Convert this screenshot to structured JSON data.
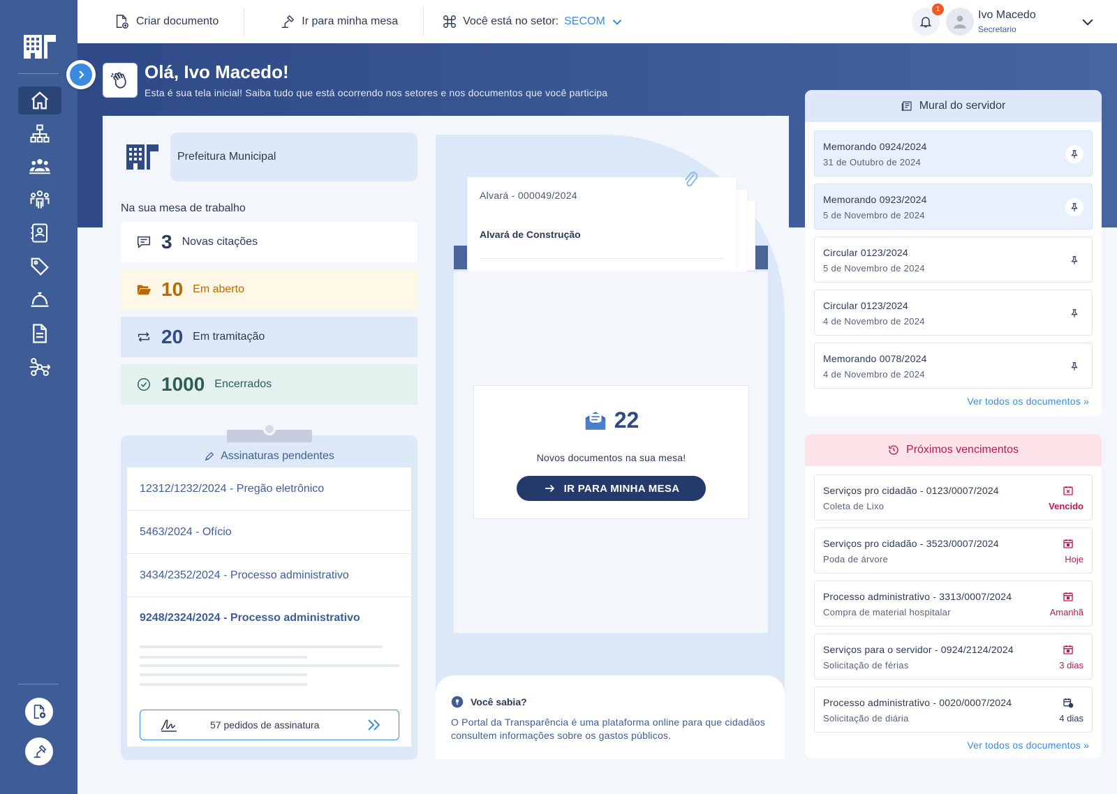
{
  "topbar": {
    "create_doc": "Criar documento",
    "go_desk": "Ir para minha mesa",
    "sector_label": "Você está no setor:",
    "sector_value": "SECOM",
    "notif_count": "1",
    "user_name": "Ivo Macedo",
    "user_role": "Secretario"
  },
  "hero": {
    "title": "Olá, Ivo Macedo!",
    "subtitle": "Esta é sua tela inicial! Saiba tudo que está ocorrendo nos setores e nos documentos que você participa"
  },
  "org": {
    "name": "Prefeitura Municipal"
  },
  "desk": {
    "title": "Na sua mesa de trabalho",
    "stats": [
      {
        "num": "3",
        "label": "Novas citações"
      },
      {
        "num": "10",
        "label": "Em aberto"
      },
      {
        "num": "20",
        "label": "Em tramitação"
      },
      {
        "num": "1000",
        "label": "Encerrados"
      }
    ]
  },
  "signatures": {
    "title": "Assinaturas pendentes",
    "items": [
      "12312/1232/2024 - Pregão eletrônico",
      "5463/2024 - Ofício",
      "3434/2352/2024 - Processo administrativo",
      "9248/2324/2024 - Processo administrativo"
    ],
    "button": "57 pedidos de assinatura"
  },
  "inbox": {
    "doc_number": "Alvará - 000049/2024",
    "doc_title": "Alvará de Construção",
    "count": "22",
    "label": "Novos documentos na sua mesa!",
    "button": "IR PARA MINHA MESA"
  },
  "tip": {
    "title": "Você sabia?",
    "text": "O Portal da Transparência é uma plataforma online para que cidadãos consultem informações sobre os gastos públicos."
  },
  "mural": {
    "title": "Mural do servidor",
    "items": [
      {
        "title": "Memorando 0924/2024",
        "date": "31 de Outubro de 2024"
      },
      {
        "title": "Memorando 0923/2024",
        "date": "5 de Novembro de 2024"
      },
      {
        "title": "Circular 0123/2024",
        "date": "5 de Novembro de 2024"
      },
      {
        "title": "Circular 0123/2024",
        "date": "4 de Novembro de 2024"
      },
      {
        "title": "Memorando 0078/2024",
        "date": "4 de Novembro de 2024"
      }
    ],
    "see_all": "Ver todos os documentos"
  },
  "deadlines": {
    "title": "Próximos vencimentos",
    "items": [
      {
        "title": "Serviços pro cidadão - 0123/0007/2024",
        "sub": "Coleta de Lixo",
        "status": "Vencido"
      },
      {
        "title": "Serviços pro cidadão - 3523/0007/2024",
        "sub": "Poda de árvore",
        "status": "Hoje"
      },
      {
        "title": "Processo administrativo - 3313/0007/2024",
        "sub": "Compra de material hospitalar",
        "status": "Amanhã"
      },
      {
        "title": "Serviços para o servidor - 0924/2124/2024",
        "sub": "Solicitação de férias",
        "status": "3 dias"
      },
      {
        "title": "Processo administrativo - 0020/0007/2024",
        "sub": "Solicitação de diária",
        "status": "4 dias"
      }
    ],
    "see_all": "Ver todos os documentos"
  },
  "colors": {
    "sidebar": "#3e5d97",
    "navy": "#243a6a",
    "accent": "#3a8be0",
    "open_bg": "#fff8e6",
    "open_text": "#b76a00",
    "transit_bg": "#dde9f8",
    "closed_bg": "#e3f2ee",
    "closed_text": "#2e5d52",
    "alert": "#c0174f"
  }
}
